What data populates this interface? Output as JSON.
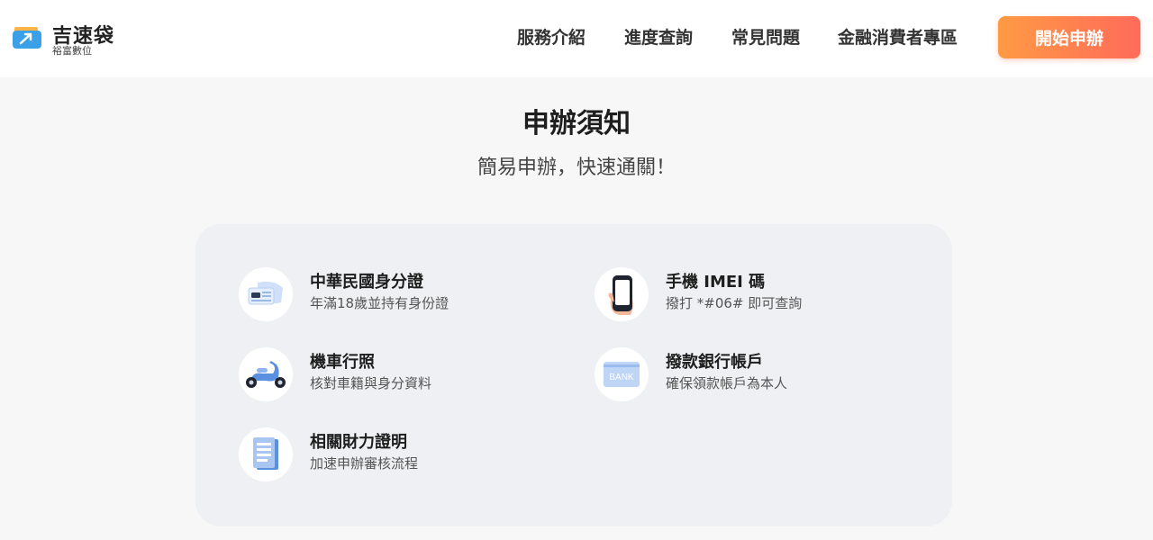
{
  "header": {
    "logo": {
      "name": "吉速袋",
      "sub": "裕富數位",
      "icon": "wallet-logo-icon"
    },
    "nav": [
      {
        "label": "服務介紹"
      },
      {
        "label": "進度查詢"
      },
      {
        "label": "常見問題"
      },
      {
        "label": "金融消費者專區"
      }
    ],
    "cta_label": "開始申辦"
  },
  "main": {
    "title": "申辦須知",
    "subtitle": "簡易申辦，快速通關！"
  },
  "requirements": [
    {
      "title": "中華民國身分證",
      "desc": "年滿18歲並持有身份證",
      "icon": "id-card-icon"
    },
    {
      "title": "手機 IMEI 碼",
      "desc": "撥打 *#06# 即可查詢",
      "icon": "phone-icon"
    },
    {
      "title": "機車行照",
      "desc": "核對車籍與身分資料",
      "icon": "scooter-icon"
    },
    {
      "title": "撥款銀行帳戶",
      "desc": "確保領款帳戶為本人",
      "icon": "bank-card-icon",
      "icon_text": "BANK"
    },
    {
      "title": "相關財力證明",
      "desc": "加速申辦審核流程",
      "icon": "document-icon"
    }
  ],
  "colors": {
    "accent_start": "#ff9a44",
    "accent_end": "#ff6b5a",
    "icon_blue": "#5b8fe0",
    "card_bg": "#eef0f4",
    "page_bg": "#f7f7f7"
  }
}
